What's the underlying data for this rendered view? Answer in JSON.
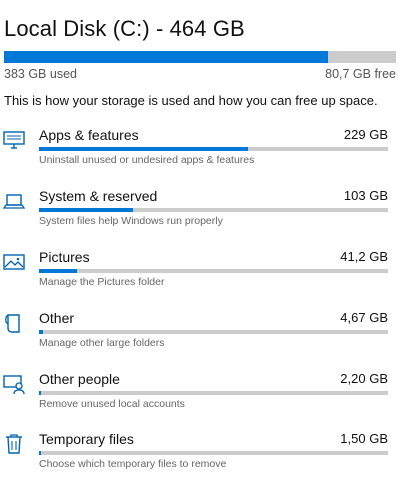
{
  "disk": {
    "title": "Local Disk (C:) - 464 GB",
    "used_label": "383 GB used",
    "free_label": "80,7 GB free",
    "used_fraction": 0.826
  },
  "intro": "This is how your storage is used and how you can free up space.",
  "accent_color": "#0078d7",
  "track_color": "#cccccc",
  "categories": [
    {
      "icon": "monitor-icon",
      "name": "Apps & features",
      "size": "229 GB",
      "fraction": 0.6,
      "description": "Uninstall unused or undesired apps & features"
    },
    {
      "icon": "laptop-icon",
      "name": "System & reserved",
      "size": "103 GB",
      "fraction": 0.27,
      "description": "System files help Windows run properly"
    },
    {
      "icon": "picture-icon",
      "name": "Pictures",
      "size": "41,2 GB",
      "fraction": 0.108,
      "description": "Manage the Pictures folder"
    },
    {
      "icon": "folder-icon",
      "name": "Other",
      "size": "4,67 GB",
      "fraction": 0.012,
      "description": "Manage other large folders"
    },
    {
      "icon": "user-monitor-icon",
      "name": "Other people",
      "size": "2,20 GB",
      "fraction": 0.006,
      "description": "Remove unused local accounts"
    },
    {
      "icon": "trash-icon",
      "name": "Temporary files",
      "size": "1,50 GB",
      "fraction": 0.004,
      "description": "Choose which temporary files to remove"
    }
  ]
}
